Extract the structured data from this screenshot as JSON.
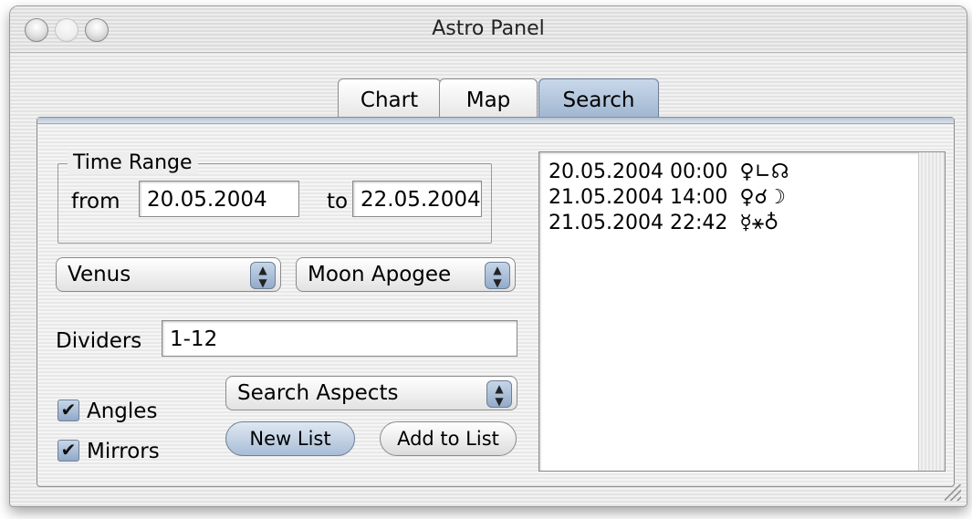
{
  "window": {
    "title": "Astro Panel"
  },
  "tabs": [
    {
      "label": "Chart",
      "selected": false
    },
    {
      "label": "Map",
      "selected": false
    },
    {
      "label": "Search",
      "selected": true
    }
  ],
  "time_range": {
    "title": "Time Range",
    "from_label": "from",
    "from_value": "20.05.2004",
    "to_label": "to",
    "to_value": "22.05.2004"
  },
  "selectors": {
    "planet": "Venus",
    "target": "Moon Apogee"
  },
  "dividers": {
    "label": "Dividers",
    "value": "1-12"
  },
  "search_mode": "Search Aspects",
  "checkboxes": [
    {
      "label": "Angles",
      "checked": true
    },
    {
      "label": "Mirrors",
      "checked": true
    }
  ],
  "buttons": {
    "new_list": "New List",
    "add_to_list": "Add to List"
  },
  "results": [
    {
      "datetime": "20.05.2004 00:00",
      "symbols": "♀∟☊"
    },
    {
      "datetime": "21.05.2004 14:00",
      "symbols": "♀☌☽"
    },
    {
      "datetime": "21.05.2004 22:42",
      "symbols": "☿⚹♁"
    }
  ],
  "colors": {
    "accent": "#9fb6d1",
    "panel": "#eeeeee"
  }
}
